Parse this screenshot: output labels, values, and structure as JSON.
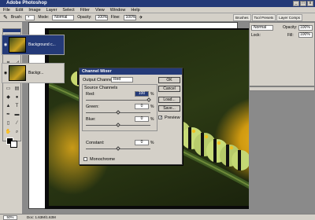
{
  "app": {
    "title": "Adobe Photoshop",
    "window_buttons": [
      "_",
      "□",
      "x"
    ]
  },
  "menu": [
    "File",
    "Edit",
    "Image",
    "Layer",
    "Select",
    "Filter",
    "View",
    "Window",
    "Help"
  ],
  "options": {
    "brush_label": "Brush:",
    "mode_label": "Mode:",
    "mode_value": "Normal",
    "opacity_label": "Opacity:",
    "opacity_value": "100%",
    "flow_label": "Flow:",
    "flow_value": "100%",
    "palette_tabs": [
      "Brushes",
      "Tool Presets",
      "Layer Comps"
    ]
  },
  "layers_panel": {
    "blend_mode": "Normal",
    "opacity_label": "Opacity:",
    "opacity_value": "100%",
    "lock_label": "Lock:",
    "fill_label": "Fill:",
    "fill_value": "100%",
    "layers": [
      {
        "name": "Background c...",
        "visible": true,
        "selected": true
      },
      {
        "name": "Backgr...",
        "visible": true,
        "selected": false
      }
    ]
  },
  "channel_mixer": {
    "title": "Channel Mixer",
    "output_channel_label": "Output Channel:",
    "output_channel_value": "Red",
    "source_channels_label": "Source Channels",
    "red_label": "Red:",
    "red_value": "100",
    "green_label": "Green:",
    "green_value": "0",
    "blue_label": "Blue:",
    "blue_value": "0",
    "constant_label": "Constant:",
    "constant_value": "0",
    "percent": "%",
    "monochrome_label": "Monochrome",
    "monochrome_checked": false,
    "preview_label": "Preview",
    "preview_checked": true,
    "buttons": {
      "ok": "OK",
      "cancel": "Cancel",
      "load": "Load...",
      "save": "Save..."
    }
  },
  "status": {
    "zoom": "50%",
    "doc": "Doc: 1.63M/1.63M"
  },
  "colors": {
    "title_blue": "#243a78",
    "chrome": "#d4d0c8"
  }
}
